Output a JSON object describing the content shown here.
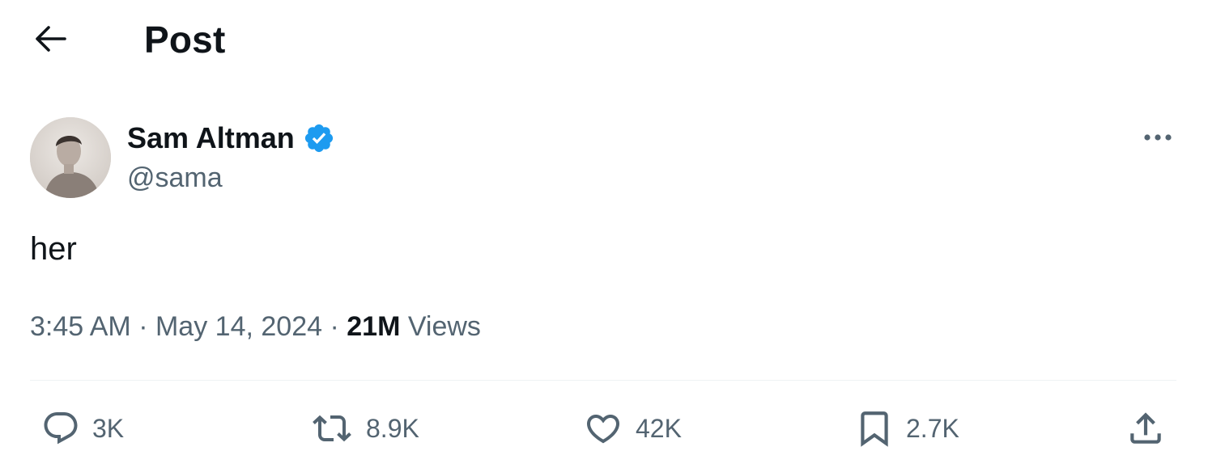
{
  "header": {
    "title": "Post",
    "back_icon": "arrow-left-icon"
  },
  "author": {
    "name": "Sam Altman",
    "handle": "@sama",
    "verified": true,
    "verified_color": "#1d9bf0"
  },
  "tweet": {
    "text": "her",
    "time": "3:45 AM",
    "separator": "·",
    "date": "May 14, 2024",
    "views_count": "21M",
    "views_label": "Views"
  },
  "actions": {
    "reply": {
      "icon": "reply-icon",
      "count": "3K"
    },
    "repost": {
      "icon": "repost-icon",
      "count": "8.9K"
    },
    "like": {
      "icon": "heart-icon",
      "count": "42K"
    },
    "bookmark": {
      "icon": "bookmark-icon",
      "count": "2.7K"
    },
    "share": {
      "icon": "share-icon"
    }
  },
  "colors": {
    "text_primary": "#0f1419",
    "text_secondary": "#536471",
    "divider": "#eff3f4",
    "accent": "#1d9bf0"
  }
}
